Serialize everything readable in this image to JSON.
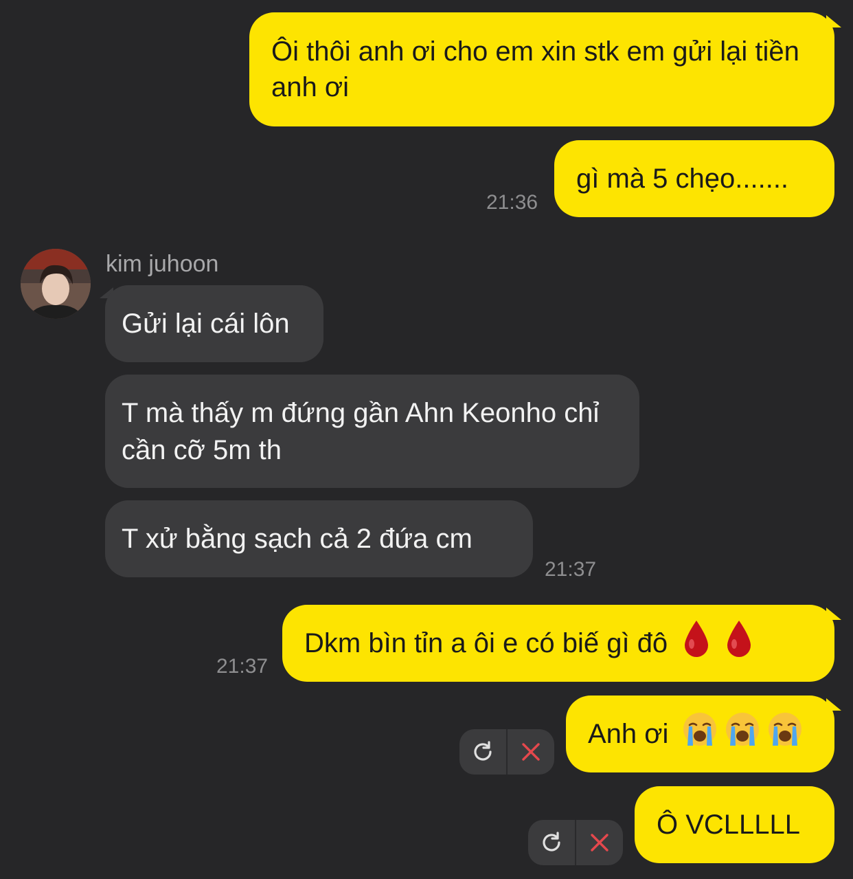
{
  "messages": {
    "m1": {
      "text": "Ôi thôi anh ơi cho em xin stk em gửi lại tiền anh ơi"
    },
    "m2": {
      "text": "gì mà 5 chẹo.......",
      "time": "21:36"
    },
    "sender_name": "kim juhoon",
    "m3": {
      "text": "Gửi lại cái lôn"
    },
    "m4": {
      "text": "T mà thấy m đứng gần Ahn Keonho chỉ cần cỡ 5m th"
    },
    "m5": {
      "text": "T xử bằng sạch cả 2 đứa cm",
      "time": "21:37"
    },
    "m6": {
      "text": "Dkm bìn tỉn a ôi e có biế gì đô",
      "time": "21:37",
      "emojis": [
        "drop-of-blood",
        "drop-of-blood"
      ]
    },
    "m7": {
      "text": "Anh ơi",
      "emojis": [
        "loudly-crying-face",
        "loudly-crying-face",
        "loudly-crying-face"
      ],
      "failed": true
    },
    "m8": {
      "text": "Ô VCLLLLL",
      "failed": true
    }
  },
  "colors": {
    "background": "#262628",
    "outgoing": "#fde401",
    "incoming": "#3b3b3d",
    "timestamp": "#8e8e90",
    "error_x": "#e5484d"
  }
}
